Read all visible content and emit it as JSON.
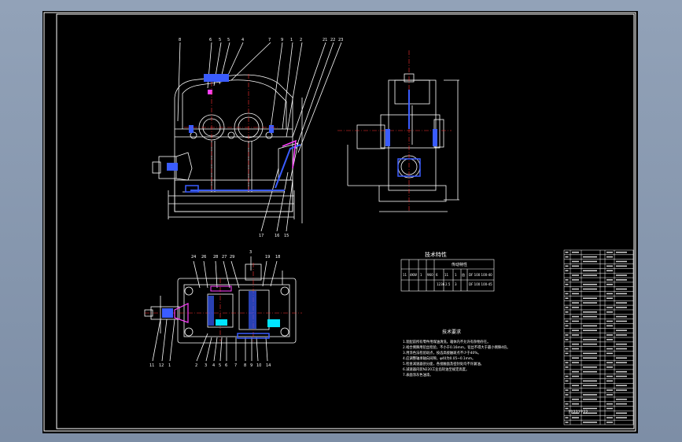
{
  "viewport": {
    "background": "#8a9ab0"
  },
  "sheet": {
    "background": "#000000",
    "line_color": "#ffffff",
    "accent_red": "#ff3030",
    "accent_blue": "#3a5cff",
    "accent_magenta": "#ff40ff",
    "accent_cyan": "#00e5ff"
  },
  "front_view": {
    "top_callouts": [
      "8",
      "6",
      "5",
      "5",
      "4",
      "7",
      "9",
      "1",
      "2",
      "21",
      "22",
      "23"
    ],
    "bottom_callouts": [
      "17",
      "16",
      "15"
    ]
  },
  "top_view": {
    "top_callouts": [
      "24",
      "26",
      "28",
      "27",
      "29",
      "3",
      "19",
      "18"
    ],
    "bottom_callouts": [
      "11",
      "12",
      "1",
      "2",
      "3",
      "4",
      "5",
      "6",
      "7",
      "8",
      "9",
      "10",
      "14"
    ]
  },
  "spec_table": {
    "title": "技术特性",
    "header_group": "传动特性",
    "row": [
      "11",
      "4KW",
      "1",
      "960",
      "6",
      "11",
      "1236",
      "2.5",
      "1",
      "齿",
      "3",
      "DF 100 100-40"
    ],
    "row2": [
      "",
      "",
      "",
      "",
      "",
      "",
      "",
      "",
      "",
      "",
      "",
      "DF 100 100-45"
    ]
  },
  "notes": {
    "title": "技术要求",
    "lines": [
      "1.装配前所有零件用煤油清洗，箱体内不允许有杂物存在。",
      "2.啮合侧隙用铅丝检验，不小于0.16mm，铅丝不得大于最小侧隙4倍。",
      "3.用涂色法检验斑点，按齿高接触斑点不少于40%。",
      "4.应调整轴承轴向间隙，φ40为0.05~0.1mm。",
      "5.检查减速器剖分面，各接触面及密封处均不许漏油。",
      "6.减速器内装N220工业齿轮油至规定高度。",
      "7.表面涂灰色油漆。"
    ]
  },
  "title_block": {
    "placeholder": "????????"
  }
}
